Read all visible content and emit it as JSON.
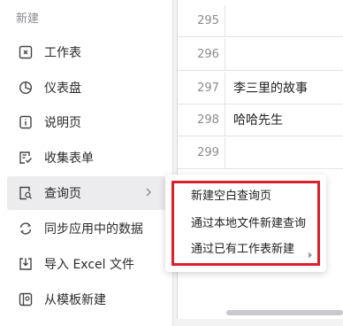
{
  "menu": {
    "section_title": "新建",
    "items": [
      {
        "label": "工作表",
        "icon": "worksheet-icon"
      },
      {
        "label": "仪表盘",
        "icon": "dashboard-icon"
      },
      {
        "label": "说明页",
        "icon": "description-page-icon"
      },
      {
        "label": "收集表单",
        "icon": "form-icon"
      },
      {
        "label": "查询页",
        "icon": "query-page-icon",
        "active": true
      },
      {
        "label": "同步应用中的数据",
        "icon": "sync-icon"
      },
      {
        "label": "导入 Excel 文件",
        "icon": "import-icon"
      },
      {
        "label": "从模板新建",
        "icon": "template-icon"
      }
    ]
  },
  "submenu": {
    "items": [
      {
        "label": "新建空白查询页"
      },
      {
        "label": "通过本地文件新建查询"
      },
      {
        "label": "通过已有工作表新建",
        "has_arrow": true
      }
    ]
  },
  "sheet": {
    "rows": [
      {
        "num": "295",
        "value": ""
      },
      {
        "num": "296",
        "value": ""
      },
      {
        "num": "297",
        "value": "李三里的故事"
      },
      {
        "num": "298",
        "value": "哈哈先生"
      },
      {
        "num": "299",
        "value": ""
      }
    ]
  },
  "colors": {
    "highlight_border": "#d8212c",
    "active_bg": "#ececee"
  }
}
